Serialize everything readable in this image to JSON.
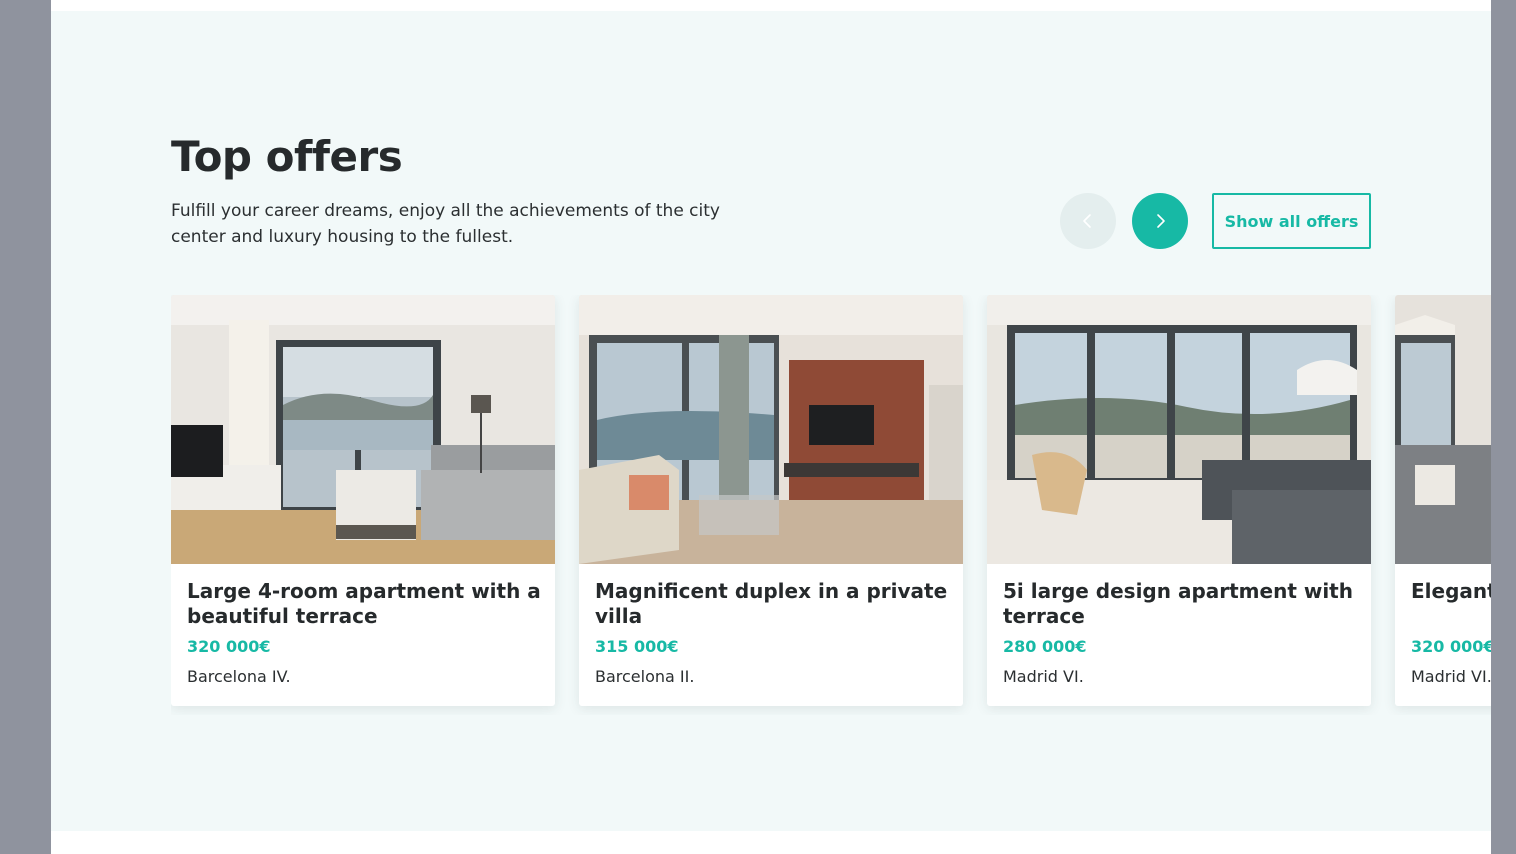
{
  "section": {
    "title": "Top offers",
    "subtitle": "Fulfill your career dreams, enjoy all the achievements of the city center and luxury housing to the fullest.",
    "show_all_label": "Show all offers"
  },
  "carousel": {
    "prev_icon": "chevron-left-icon",
    "next_icon": "chevron-right-icon",
    "prev_disabled": true
  },
  "colors": {
    "accent": "#17b9a5",
    "section_bg": "#f2f9f9",
    "heading": "#262a2c"
  },
  "offers": [
    {
      "title": "Large 4-room apartment with a beautiful terrace",
      "price": "320 000€",
      "location": "Barcelona IV."
    },
    {
      "title": "Magnificent duplex in a private villa",
      "price": "315 000€",
      "location": "Barcelona II."
    },
    {
      "title": "5i large design apartment with terrace",
      "price": "280 000€",
      "location": "Madrid VI."
    },
    {
      "title": "Elegant private",
      "price": "320 000€",
      "location": "Madrid VI."
    }
  ]
}
